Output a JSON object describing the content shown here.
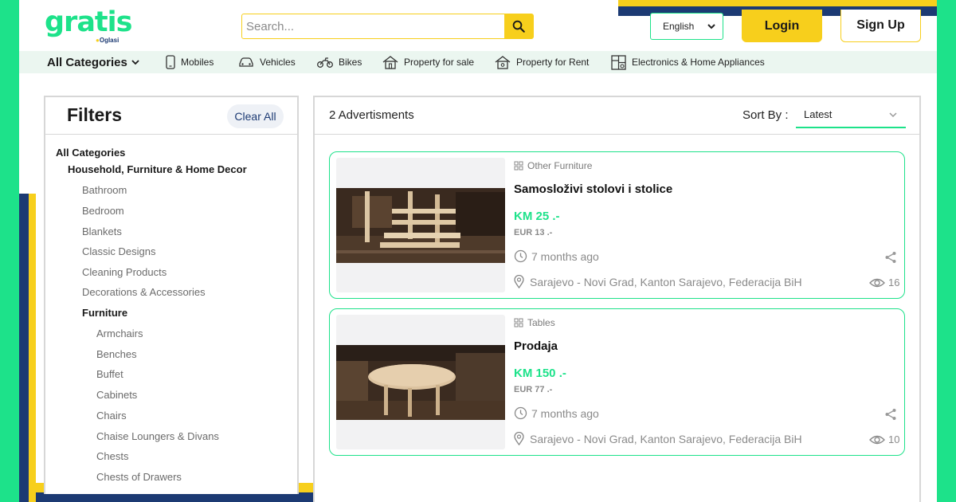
{
  "brand": {
    "name": "gratis",
    "sub": "Oglasi"
  },
  "search": {
    "placeholder": "Search...",
    "value": ""
  },
  "header": {
    "language": "English",
    "login_label": "Login",
    "signup_label": "Sign Up"
  },
  "categories_bar": {
    "all_label": "All Categories",
    "items": [
      {
        "label": "Mobiles",
        "icon": "phone-icon"
      },
      {
        "label": "Vehicles",
        "icon": "car-icon"
      },
      {
        "label": "Bikes",
        "icon": "motorbike-icon"
      },
      {
        "label": "Property for sale",
        "icon": "house-icon"
      },
      {
        "label": "Property for Rent",
        "icon": "house-key-icon"
      },
      {
        "label": "Electronics & Home Appliances",
        "icon": "appliances-icon"
      }
    ]
  },
  "filters": {
    "title": "Filters",
    "clear_label": "Clear All",
    "tree": [
      {
        "label": "All Categories",
        "level": 0
      },
      {
        "label": "Household, Furniture & Home Decor",
        "level": 1
      },
      {
        "label": "Bathroom",
        "level": 2
      },
      {
        "label": "Bedroom",
        "level": 2
      },
      {
        "label": "Blankets",
        "level": 2
      },
      {
        "label": "Classic Designs",
        "level": 2
      },
      {
        "label": "Cleaning Products",
        "level": 2
      },
      {
        "label": "Decorations & Accessories",
        "level": 2
      },
      {
        "label": "Furniture",
        "level": 2,
        "active": true
      },
      {
        "label": "Armchairs",
        "level": 3
      },
      {
        "label": "Benches",
        "level": 3
      },
      {
        "label": "Buffet",
        "level": 3
      },
      {
        "label": "Cabinets",
        "level": 3
      },
      {
        "label": "Chairs",
        "level": 3
      },
      {
        "label": "Chaise Loungers & Divans",
        "level": 3
      },
      {
        "label": "Chests",
        "level": 3
      },
      {
        "label": "Chests of Drawers",
        "level": 3
      }
    ]
  },
  "results": {
    "count_label": "2 Advertisments",
    "sort_label": "Sort By :",
    "sort_value": "Latest",
    "ads": [
      {
        "category": "Other Furniture",
        "title": "Samosloživi stolovi i stolice",
        "price": "KM 25 .-",
        "price_eur": "EUR 13 .-",
        "time": "7 months ago",
        "location": "Sarajevo - Novi Grad, Kanton Sarajevo, Federacija BiH",
        "views": "16"
      },
      {
        "category": "Tables",
        "title": "Prodaja",
        "price": "KM 150 .-",
        "price_eur": "EUR 77 .-",
        "time": "7 months ago",
        "location": "Sarajevo - Novi Grad, Kanton Sarajevo, Federacija BiH",
        "views": "10"
      }
    ]
  },
  "colors": {
    "brand_green": "#1de28a",
    "brand_yellow": "#f7cf1c",
    "brand_navy": "#1c3a73"
  }
}
